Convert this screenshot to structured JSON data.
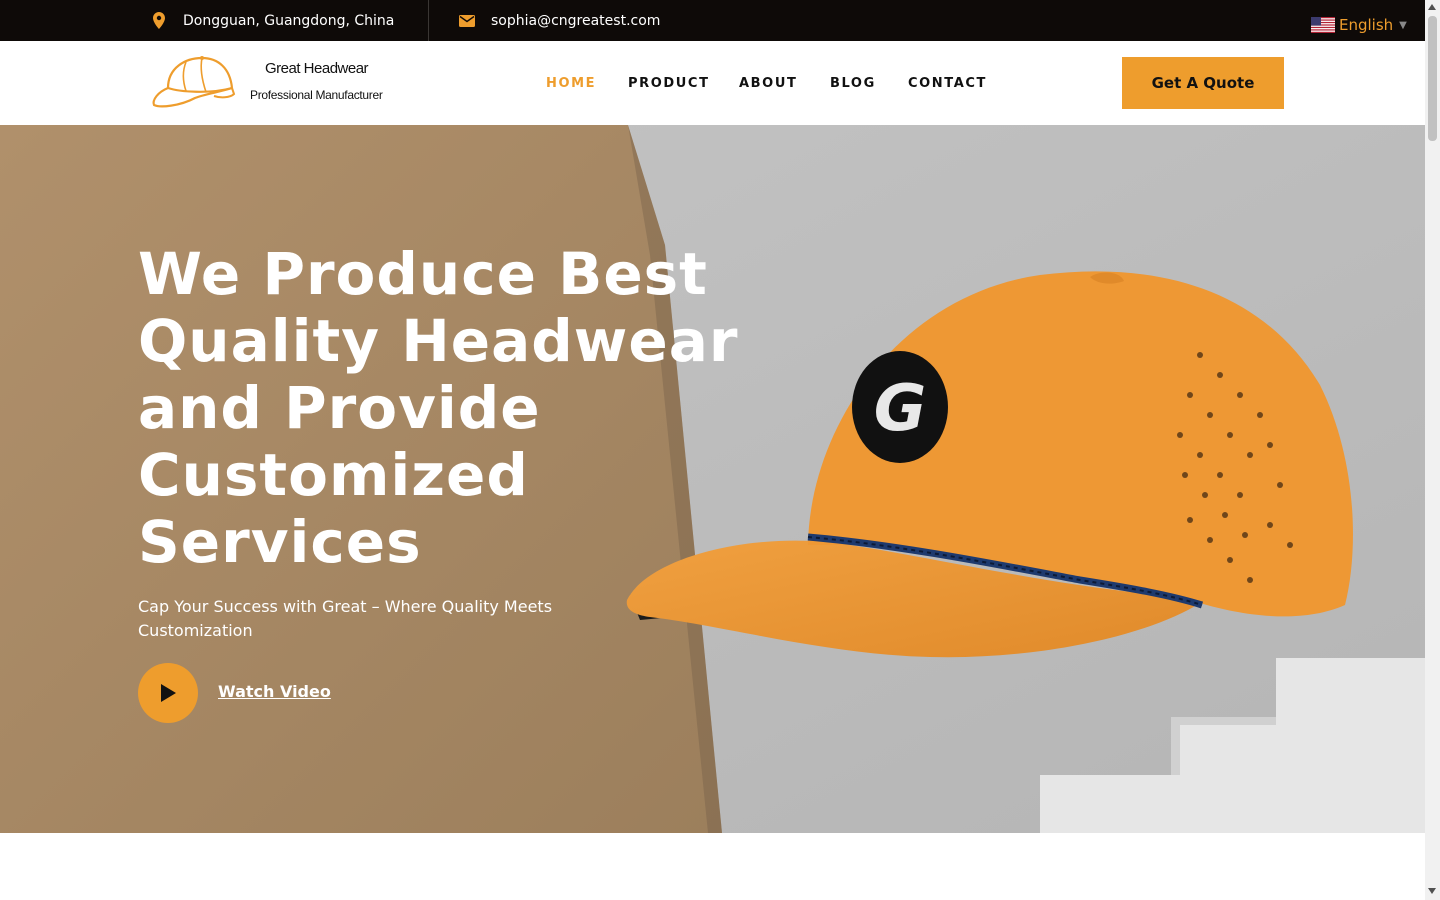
{
  "topbar": {
    "location": "Dongguan, Guangdong, China",
    "email": "sophia@cngreatest.com",
    "location_icon": "map-pin-icon",
    "email_icon": "envelope-icon",
    "language": "English"
  },
  "header": {
    "logo_brand": "Great Headwear",
    "logo_tagline": "Professional Manufacturer",
    "nav": [
      {
        "label": "HOME",
        "active": true
      },
      {
        "label": "PRODUCT",
        "active": false
      },
      {
        "label": "ABOUT",
        "active": false
      },
      {
        "label": "BLOG",
        "active": false
      },
      {
        "label": "CONTACT",
        "active": false
      }
    ],
    "cta_label": "Get A Quote"
  },
  "hero": {
    "headline_line1": "We Produce Best",
    "headline_line2_pre": "Quality ",
    "headline_highlight": "Headwear",
    "headline_line3": "and Provide",
    "headline_line4": "Customized",
    "headline_line5": "Services",
    "subtitle": "Cap Your Success with Great – Where Quality Meets Customization",
    "watch_label": "Watch Video",
    "cap_logo_letter": "G"
  },
  "colors": {
    "accent": "#ee9d2d",
    "topbar_bg": "#0e0a08",
    "kraft": "#a88a66",
    "concrete": "#bdbdbd"
  }
}
